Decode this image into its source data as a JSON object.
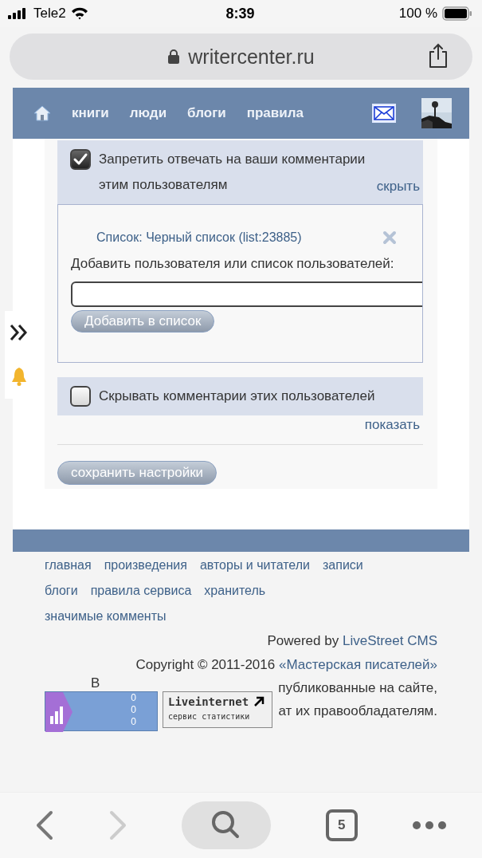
{
  "status_bar": {
    "carrier": "Tele2",
    "time": "8:39",
    "battery": "100 %"
  },
  "address_bar": {
    "url": "writercenter.ru"
  },
  "nav": {
    "items": [
      {
        "label": "книги"
      },
      {
        "label": "люди"
      },
      {
        "label": "блоги"
      },
      {
        "label": "правила"
      }
    ]
  },
  "settings": [
    {
      "label": "Запретить отвечать на ваши комментарии этим пользователям",
      "checked": true,
      "toggle": "скрыть",
      "expanded": true,
      "list_title": "Список: Черный список (list:23885)",
      "add_label": "Добавить пользователя или список пользователей:",
      "add_button": "Добавить в список"
    },
    {
      "label": "Скрывать комментарии этих пользователей",
      "checked": false,
      "toggle": "показать",
      "expanded": false
    }
  ],
  "save_button": "сохранить настройки",
  "footer": {
    "links": [
      [
        "главная",
        "произведения",
        "авторы и читатели",
        "записи"
      ],
      [
        "блоги",
        "правила сервиса",
        "хранитель"
      ],
      [
        "значимые комменты"
      ]
    ],
    "powered": "Powered by",
    "powered_link": "LiveStreet CMS",
    "copyright": "Copyright © 2011-2016",
    "copyright_link": "«Мастерская писателей»",
    "notice_fragments": [
      "В",
      "публикованные на сайте,",
      "ат их правообладателям."
    ],
    "counter": {
      "values": [
        "0",
        "0",
        "0"
      ]
    },
    "liveinternet": {
      "title": "Liveinternet",
      "subtitle": "сервис статистики"
    }
  },
  "toolbar": {
    "tabs": "5"
  }
}
